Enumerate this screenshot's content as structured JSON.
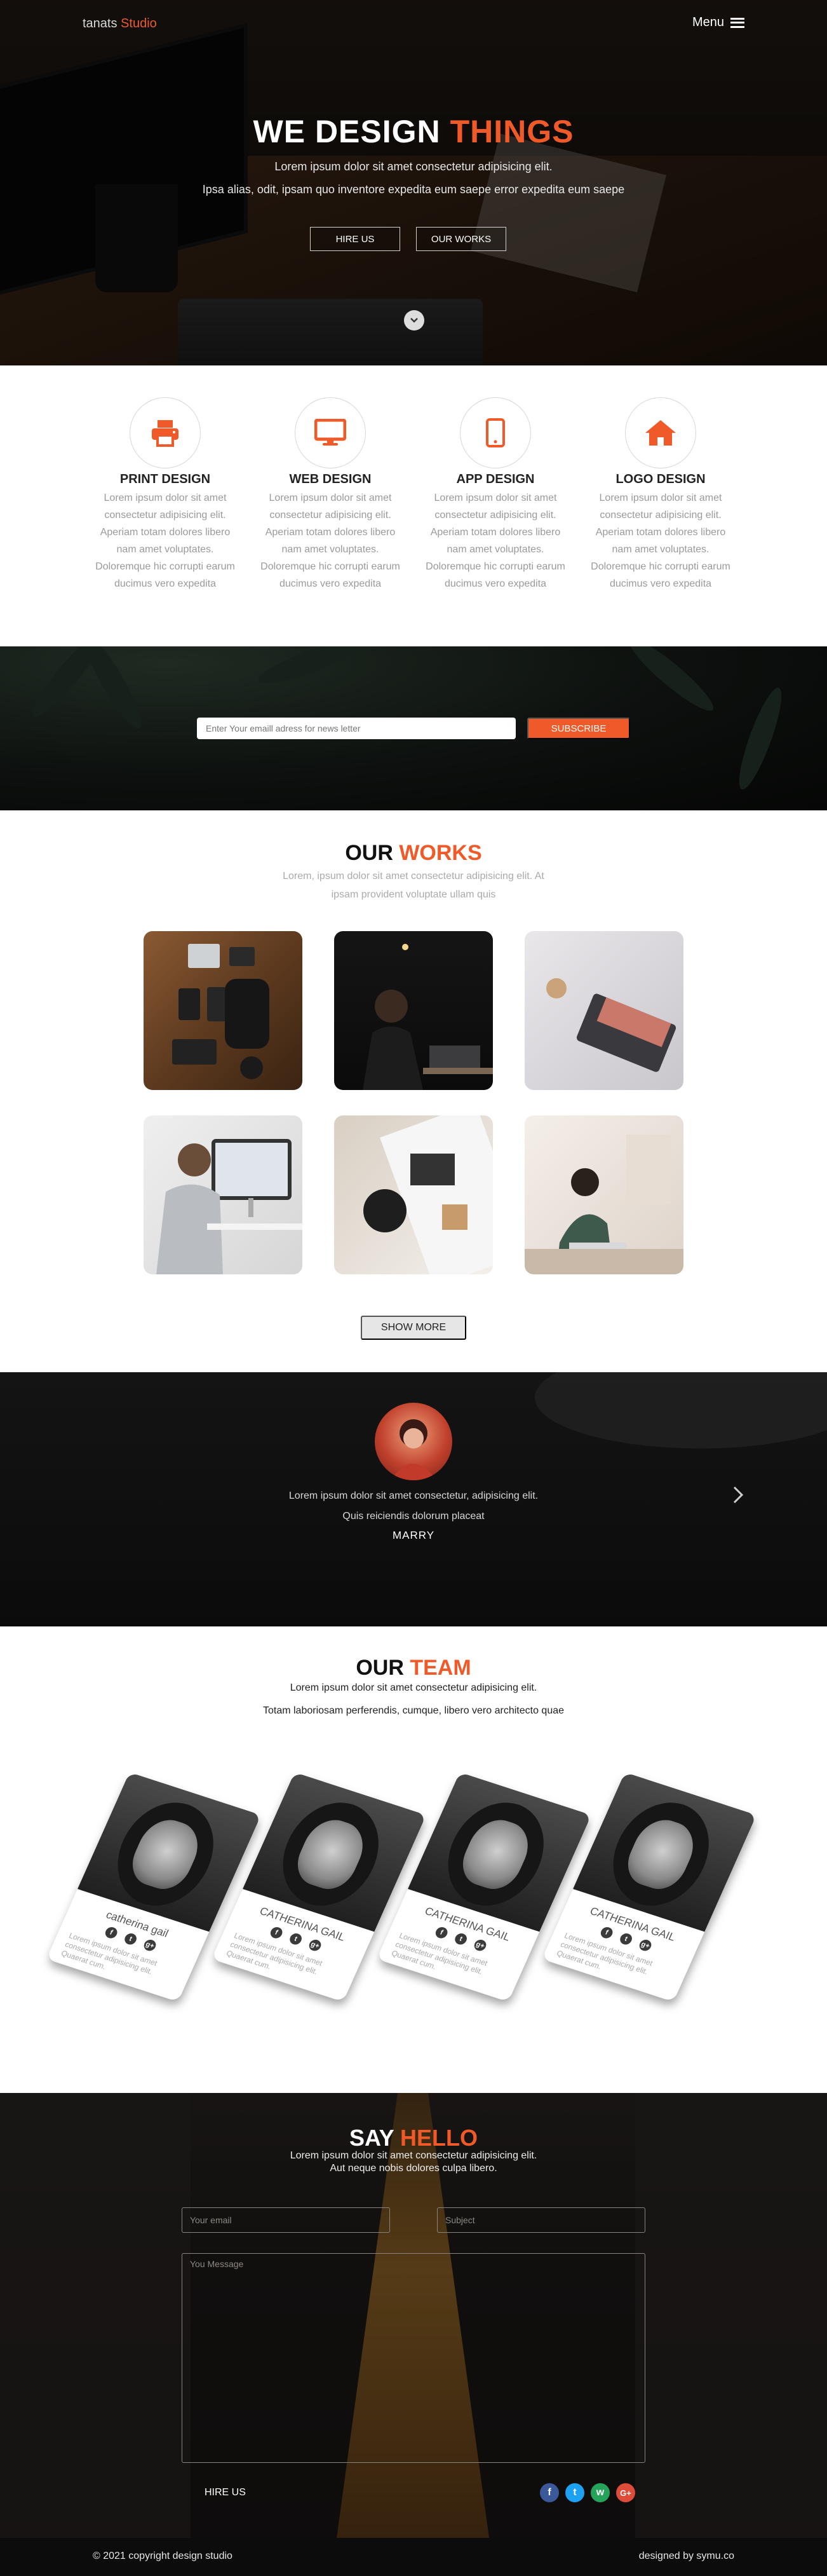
{
  "nav": {
    "brand_first": "tanats",
    "brand_second": "Studio",
    "menu_label": "Menu"
  },
  "hero": {
    "title_white": "WE DESIGN",
    "title_orange": "THINGS",
    "subtitle_line1": "Lorem ipsum dolor sit amet consectetur adipisicing elit.",
    "subtitle_line2": "Ipsa alias, odit, ipsam quo inventore expedita eum saepe error expedita eum saepe",
    "hire_button": "HIRE US",
    "works_button": "OUR WORKS"
  },
  "services": [
    {
      "title": "PRINT DESIGN",
      "icon": "printer-icon",
      "text": "Lorem ipsum dolor sit amet consectetur adipisicing elit. Aperiam totam dolores libero nam amet voluptates. Doloremque hic corrupti earum ducimus vero expedita"
    },
    {
      "title": "WEB DESIGN",
      "icon": "monitor-icon",
      "text": "Lorem ipsum dolor sit amet consectetur adipisicing elit. Aperiam totam dolores libero nam amet voluptates. Doloremque hic corrupti earum ducimus vero expedita"
    },
    {
      "title": "APP DESIGN",
      "icon": "mobile-icon",
      "text": "Lorem ipsum dolor sit amet consectetur adipisicing elit. Aperiam totam dolores libero nam amet voluptates. Doloremque hic corrupti earum ducimus vero expedita"
    },
    {
      "title": "LOGO DESIGN",
      "icon": "home-icon",
      "text": "Lorem ipsum dolor sit amet consectetur adipisicing elit. Aperiam totam dolores libero nam amet voluptates. Doloremque hic corrupti earum ducimus vero expedita"
    }
  ],
  "newsletter": {
    "placeholder": "Enter Your emaill adress for news letter",
    "button": "SUBSCRIBE"
  },
  "works": {
    "title_dark": "OUR",
    "title_orange": "WORKS",
    "subtitle_line1": "Lorem, ipsum dolor sit amet consectetur adipisicing elit. At",
    "subtitle_line2": "ipsam provident voluptate ullam quis",
    "show_more": "SHOW MORE"
  },
  "testimonial": {
    "quote_line1": "Lorem ipsum dolor sit amet consectetur, adipisicing elit.",
    "quote_line2": "Quis reiciendis dolorum placeat",
    "name": "MARRY"
  },
  "team": {
    "title_dark": "OUR",
    "title_orange": "TEAM",
    "subtitle_line1": "Lorem ipsum dolor sit amet consectetur adipisicing elit.",
    "subtitle_line2": "Totam laboriosam perferendis, cumque, libero vero architecto quae",
    "members": [
      {
        "name": "catherina gail",
        "text": "Lorem ipsum dolor sit amet consectetur adipisicing elit. Quaerat cum."
      },
      {
        "name": "CATHERINA GAIL",
        "text": "Lorem ipsum dolor sit amet consectetur adipisicing elit. Quaerat cum."
      },
      {
        "name": "CATHERINA GAIL",
        "text": "Lorem ipsum dolor sit amet consectetur adipisicing elit. Quaerat cum."
      },
      {
        "name": "CATHERINA GAIL",
        "text": "Lorem ipsum dolor sit amet consectetur adipisicing elit. Quaerat cum."
      }
    ]
  },
  "contact": {
    "title_white": "SAY",
    "title_orange": "HELLO",
    "subtitle_line1": "Lorem ipsum dolor sit amet consectetur adipisicing elit.",
    "subtitle_line2": "Aut neque nobis dolores culpa libero.",
    "email_placeholder": "Your email",
    "subject_placeholder": "Subject",
    "message_placeholder": "You Message",
    "hire_label": "HIRE US",
    "socials": [
      {
        "icon": "facebook-icon",
        "color": "#3b5998"
      },
      {
        "icon": "twitter-icon",
        "color": "#1da1f2"
      },
      {
        "icon": "whatsapp-icon",
        "color": "#25a35a"
      },
      {
        "icon": "google-plus-icon",
        "color": "#dd4b39"
      }
    ]
  },
  "footer": {
    "copyright": "© 2021 copyright design studio",
    "designed_by": "designed by symu.co"
  },
  "colors": {
    "accent": "#f05a28",
    "dark": "#0c0c0c"
  }
}
